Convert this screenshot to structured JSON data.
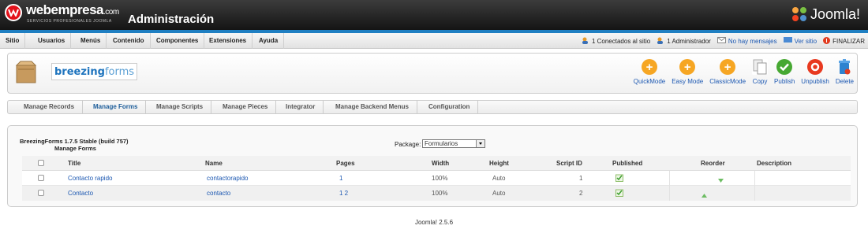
{
  "header": {
    "brand": "webempresa",
    "brand_suffix": ".com",
    "brand_tagline": "SERVICIOS PROFESIONALES JOOMLA",
    "title": "Administración",
    "joomla_logo_text": "Joomla!"
  },
  "menu": [
    "Sitio",
    "Usuarios",
    "Menús",
    "Contenido",
    "Componentes",
    "Extensiones",
    "Ayuda"
  ],
  "status": {
    "online_site": "1 Conectados al sitio",
    "admin": "1 Administrador",
    "messages": "No hay mensajes",
    "view_site": "Ver sitio",
    "logout": "FINALIZAR"
  },
  "component": {
    "logo_bold": "breezing",
    "logo_light": "forms"
  },
  "toolbar": [
    {
      "label": "QuickMode",
      "icon": "plus-icon",
      "color": "#f6a623"
    },
    {
      "label": "Easy Mode",
      "icon": "plus-icon",
      "color": "#f6a623"
    },
    {
      "label": "ClassicMode",
      "icon": "plus-icon",
      "color": "#f6a623"
    },
    {
      "label": "Copy",
      "icon": "copy-icon",
      "color": "#c9c9c9"
    },
    {
      "label": "Publish",
      "icon": "check-icon",
      "color": "#46a832"
    },
    {
      "label": "Unpublish",
      "icon": "unpublish-icon",
      "color": "#e8391f"
    },
    {
      "label": "Delete",
      "icon": "trash-icon",
      "color": "#2e82cf"
    }
  ],
  "subtabs": [
    "Manage Records",
    "Manage Forms",
    "Manage Scripts",
    "Manage Pieces",
    "Integrator",
    "Manage Backend Menus",
    "Configuration"
  ],
  "active_subtab": "Manage Forms",
  "version": "BreezingForms 1.7.5 Stable (build 757)",
  "section_title": "Manage Forms",
  "package": {
    "label": "Package:",
    "selected": "Formularios"
  },
  "table": {
    "headers": [
      "Title",
      "Name",
      "Pages",
      "Width",
      "Height",
      "Script ID",
      "Published",
      "Reorder",
      "Description"
    ],
    "rows": [
      {
        "title": "Contacto rapido",
        "name": "contactorapido",
        "pages": "1",
        "width": "100%",
        "height": "Auto",
        "script_id": "1",
        "published": true,
        "reorder": "down",
        "description": ""
      },
      {
        "title": "Contacto",
        "name": "contacto",
        "pages": "1 2",
        "width": "100%",
        "height": "Auto",
        "script_id": "2",
        "published": true,
        "reorder": "up",
        "description": ""
      }
    ]
  },
  "footer": "Joomla! 2.5.6"
}
